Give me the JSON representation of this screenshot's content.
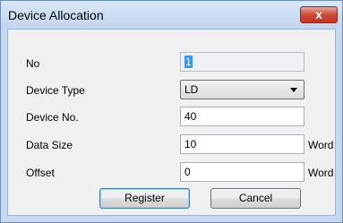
{
  "window": {
    "title": "Device Allocation",
    "close_glyph": "x"
  },
  "form": {
    "no": {
      "label": "No",
      "value": "1"
    },
    "device_type": {
      "label": "Device Type",
      "selected": "LD"
    },
    "device_no": {
      "label": "Device No.",
      "value": "40"
    },
    "data_size": {
      "label": "Data Size",
      "value": "10",
      "unit": "Word"
    },
    "offset": {
      "label": "Offset",
      "value": "0",
      "unit": "Word"
    }
  },
  "buttons": {
    "register": "Register",
    "cancel": "Cancel"
  },
  "colors": {
    "title_bar": "#c7d9ef",
    "close_button": "#c23420",
    "selection": "#3399ff"
  }
}
